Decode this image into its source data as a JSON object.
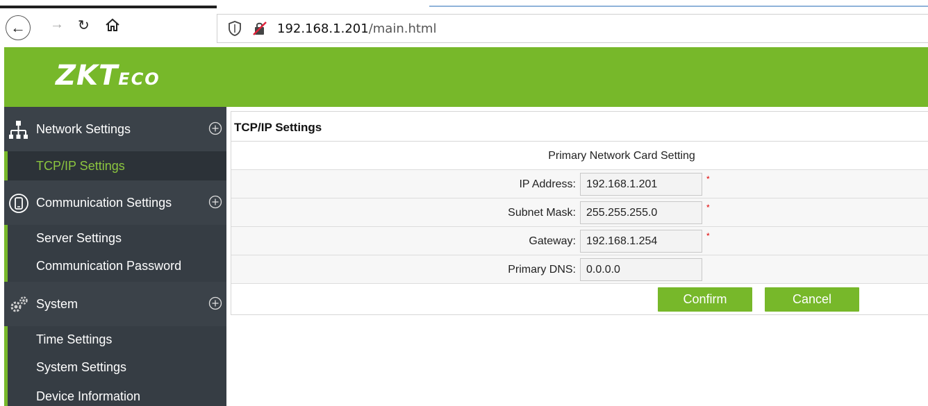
{
  "browser": {
    "url_host": "192.168.1.201",
    "url_path": "/main.html"
  },
  "header": {
    "logo_main": "ZKT",
    "logo_suffix": "ECO",
    "brand_color": "#77b82a"
  },
  "sidebar": {
    "groups": [
      {
        "label": "Network Settings",
        "icon": "network-icon",
        "items": [
          {
            "label": "TCP/IP Settings",
            "active": true
          }
        ]
      },
      {
        "label": "Communication Settings",
        "icon": "communication-icon",
        "items": [
          {
            "label": "Server Settings",
            "active": false
          },
          {
            "label": "Communication Password",
            "active": false
          }
        ]
      },
      {
        "label": "System",
        "icon": "gears-icon",
        "items": [
          {
            "label": "Time Settings",
            "active": false
          },
          {
            "label": "System Settings",
            "active": false
          },
          {
            "label": "Device Information",
            "active": false
          }
        ]
      }
    ]
  },
  "main": {
    "panel_title": "TCP/IP Settings",
    "section_title": "Primary Network Card Setting",
    "fields": [
      {
        "label": "IP Address:",
        "value": "192.168.1.201",
        "required": "*"
      },
      {
        "label": "Subnet Mask:",
        "value": "255.255.255.0",
        "required": "*"
      },
      {
        "label": "Gateway:",
        "value": "192.168.1.254",
        "required": "*"
      },
      {
        "label": "Primary DNS:",
        "value": "0.0.0.0",
        "required": ""
      }
    ],
    "confirm_label": "Confirm",
    "cancel_label": "Cancel"
  }
}
